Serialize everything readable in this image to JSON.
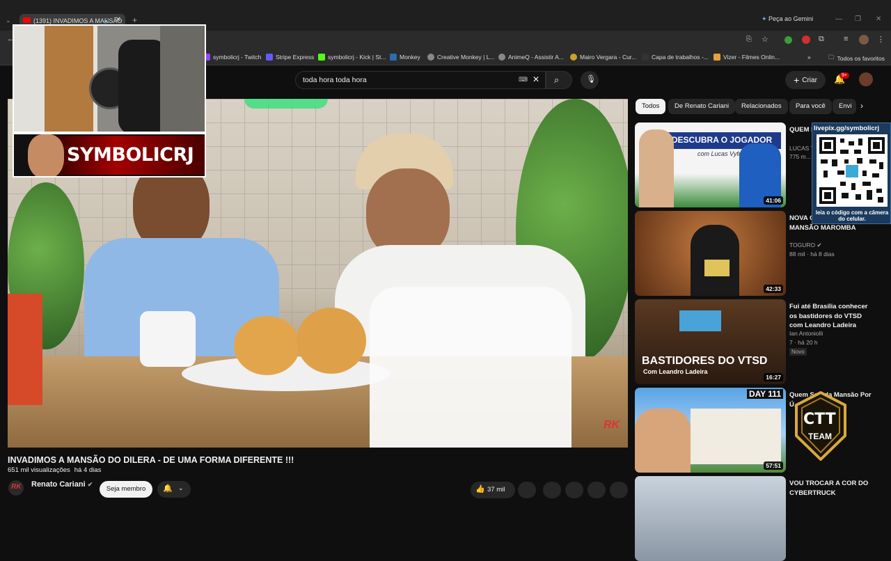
{
  "browser": {
    "tab_title": "(1391) INVADIMOS A MANSÃO",
    "gemini": "Peça ao Gemini",
    "bookmarks": [
      "symbolicrj - Twitch",
      "Stripe Express",
      "symbolicrj - Kick | St...",
      "Monkey",
      "Creative Monkey | L...",
      "AnimeQ - Assistir A...",
      "Mairo Vergara - Cur...",
      "Capa de trabalhos -...",
      "Vizer - Filmes Onlin..."
    ],
    "bookmarks_overflow": "»",
    "all_favorites": "Todos os favoritos"
  },
  "header": {
    "search_query": "toda hora toda hora",
    "create_label": "Criar",
    "notification_count": "9+"
  },
  "overlay": {
    "streamer_name": "SYMBOLICRJ",
    "qr_url": "livepix.gg/symbolicrj",
    "qr_caption": "leia o código com a câmera do celular."
  },
  "video": {
    "title": "INVADIMOS A MANSÃO DO DILERA - DE UMA FORMA DIFERENTE !!!",
    "views": "651 mil visualizações",
    "age": "há 4 dias",
    "channel": "Renato Cariani",
    "join_label": "Seja membro",
    "likes": "37 mil"
  },
  "chips": [
    "Todos",
    "De Renato Cariani",
    "Relacionados",
    "Para você",
    "Envi"
  ],
  "recommendations": [
    {
      "title": "QUEM E... PROFIS...",
      "channel": "LUCAS T...",
      "meta": "775 m...",
      "duration": "41:06",
      "thumb_text": "DESCUBRA O JOGADOR",
      "thumb_sub": "com Lucas Vyfry"
    },
    {
      "title": "NOVA C... DE OVO DA MANSÃO MAROMBA",
      "channel": "TOGURO",
      "meta": "88 mil · há 8 dias",
      "duration": "42:33",
      "thumb_text": "",
      "thumb_sub": ""
    },
    {
      "title": "Fui até Brasília conhecer os bastidores do VTSD com Leandro Ladeira",
      "channel": "Ian Antoniolli",
      "meta": "7 · há 20 h",
      "badge": "Novo",
      "duration": "16:27",
      "thumb_text": "BASTIDORES DO VTSD",
      "thumb_sub": "Com Leandro Ladeira"
    },
    {
      "title": "Quem Sair da Mansão Por Ú... Ela!",
      "channel": "",
      "meta": "",
      "duration": "57:51",
      "thumb_text": "DAY 111",
      "thumb_sub": ""
    },
    {
      "title": "VOU TROCAR A COR DO CYBERTRUCK",
      "channel": "",
      "meta": "",
      "duration": "",
      "thumb_text": "",
      "thumb_sub": ""
    }
  ],
  "ctt": {
    "line1": "CTT",
    "line2": "TEAM"
  }
}
